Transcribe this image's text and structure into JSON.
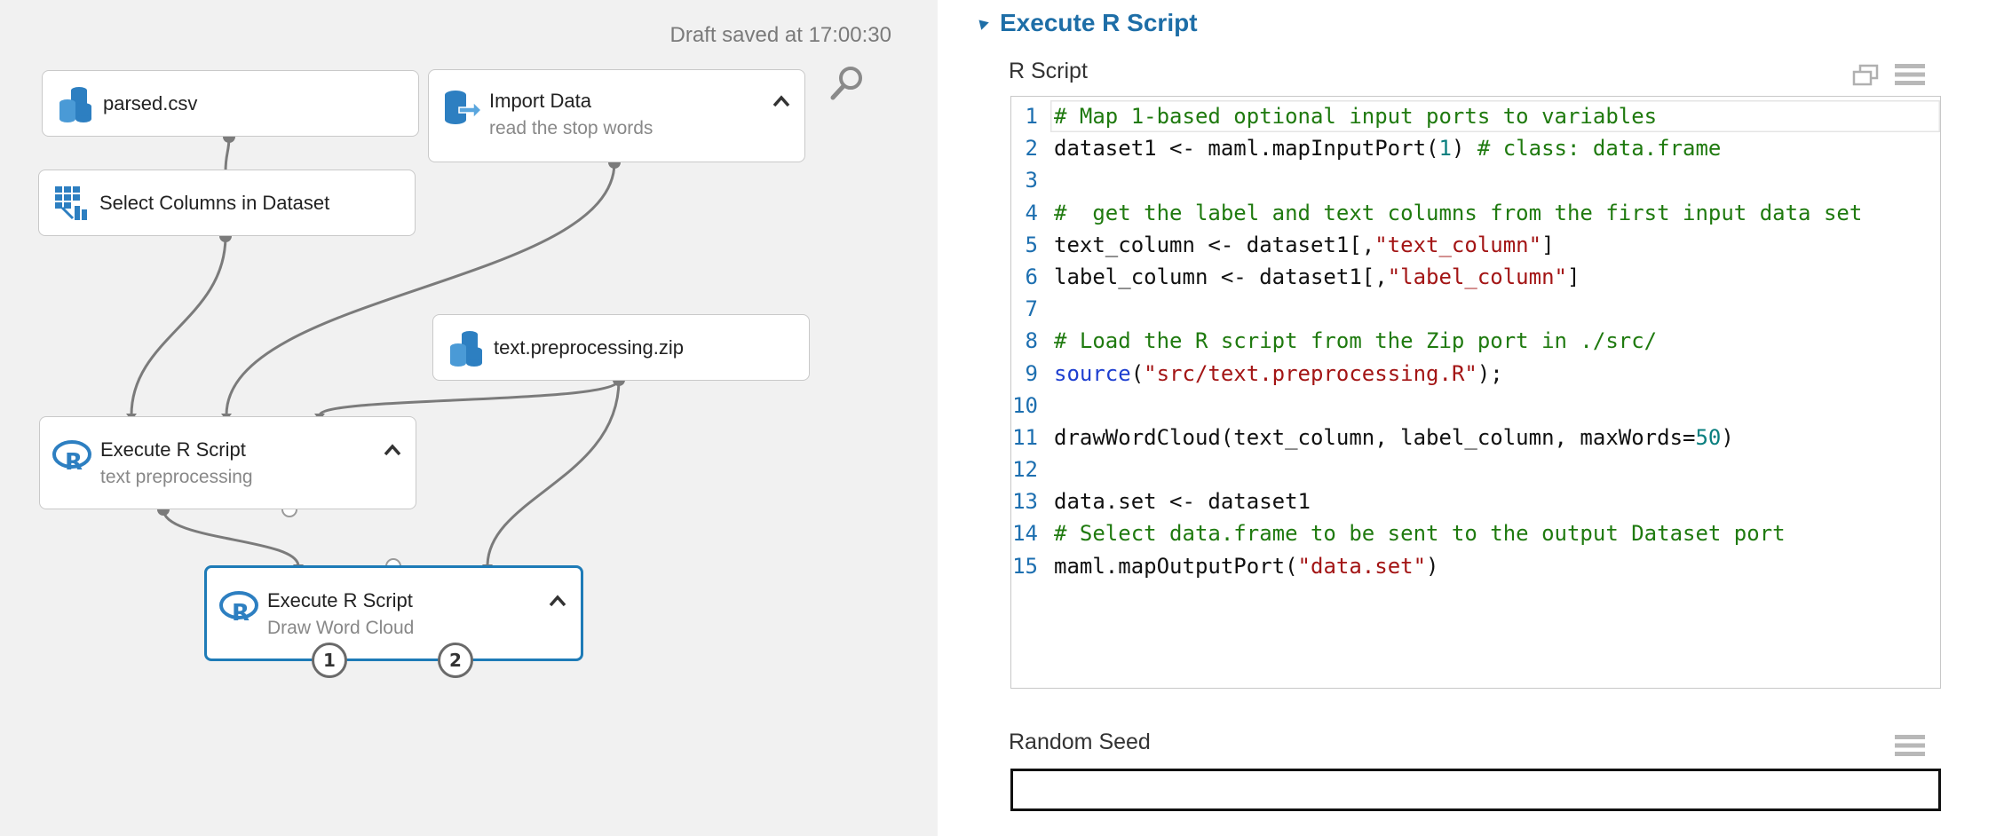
{
  "canvas": {
    "draft_status": "Draft saved at 17:00:30",
    "search_icon": "magnifier-icon",
    "nodes": {
      "parsed": {
        "title": "parsed.csv",
        "icon": "dataset-icon"
      },
      "import": {
        "title": "Import Data",
        "subtitle": "read the stop words",
        "icon": "import-icon"
      },
      "select": {
        "title": "Select Columns in Dataset",
        "icon": "select-columns-icon"
      },
      "zip": {
        "title": "text.preprocessing.zip",
        "icon": "dataset-icon"
      },
      "exec1": {
        "title": "Execute R Script",
        "subtitle": "text preprocessing",
        "icon": "r-logo-icon"
      },
      "exec2": {
        "title": "Execute R Script",
        "subtitle": "Draw Word Cloud",
        "icon": "r-logo-icon"
      }
    },
    "output_ports": [
      "1",
      "2"
    ]
  },
  "panel": {
    "section_title": "Execute R Script",
    "rscript_label": "R Script",
    "random_seed_label": "Random Seed",
    "random_seed_value": "",
    "code_lines": [
      {
        "n": "1",
        "segs": [
          [
            "c",
            "# Map 1-based optional input ports to variables"
          ]
        ]
      },
      {
        "n": "2",
        "segs": [
          [
            "p",
            "dataset1 <- maml.mapInputPort("
          ],
          [
            "n",
            "1"
          ],
          [
            "p",
            ") "
          ],
          [
            "c",
            "# class: data.frame"
          ]
        ]
      },
      {
        "n": "3",
        "segs": []
      },
      {
        "n": "4",
        "segs": [
          [
            "c",
            "#  get the label and text columns from the first input data set"
          ]
        ]
      },
      {
        "n": "5",
        "segs": [
          [
            "p",
            "text_column <- dataset1[,"
          ],
          [
            "s",
            "\"text_column\""
          ],
          [
            "p",
            "]"
          ]
        ]
      },
      {
        "n": "6",
        "segs": [
          [
            "p",
            "label_column <- dataset1[,"
          ],
          [
            "s",
            "\"label_column\""
          ],
          [
            "p",
            "]"
          ]
        ]
      },
      {
        "n": "7",
        "segs": []
      },
      {
        "n": "8",
        "segs": [
          [
            "c",
            "# Load the R script from the Zip port in ./src/"
          ]
        ]
      },
      {
        "n": "9",
        "segs": [
          [
            "k",
            "source"
          ],
          [
            "p",
            "("
          ],
          [
            "s",
            "\"src/text.preprocessing.R\""
          ],
          [
            "p",
            ");"
          ]
        ]
      },
      {
        "n": "10",
        "segs": []
      },
      {
        "n": "11",
        "segs": [
          [
            "p",
            "drawWordCloud(text_column, label_column, maxWords="
          ],
          [
            "n",
            "50"
          ],
          [
            "p",
            ")"
          ]
        ]
      },
      {
        "n": "12",
        "segs": []
      },
      {
        "n": "13",
        "segs": [
          [
            "p",
            "data.set <- dataset1"
          ]
        ]
      },
      {
        "n": "14",
        "segs": [
          [
            "c",
            "# Select data.frame to be sent to the output Dataset port"
          ]
        ]
      },
      {
        "n": "15",
        "segs": [
          [
            "p",
            "maml.mapOutputPort("
          ],
          [
            "s",
            "\"data.set\""
          ],
          [
            "p",
            ")"
          ]
        ]
      }
    ]
  },
  "colors": {
    "accent": "#1e6ea7",
    "comment": "#1f7a0f",
    "string": "#a31515",
    "number": "#0a7f7f",
    "keyword": "#1e3fd0",
    "canvas_bg": "#f1f1f1"
  }
}
